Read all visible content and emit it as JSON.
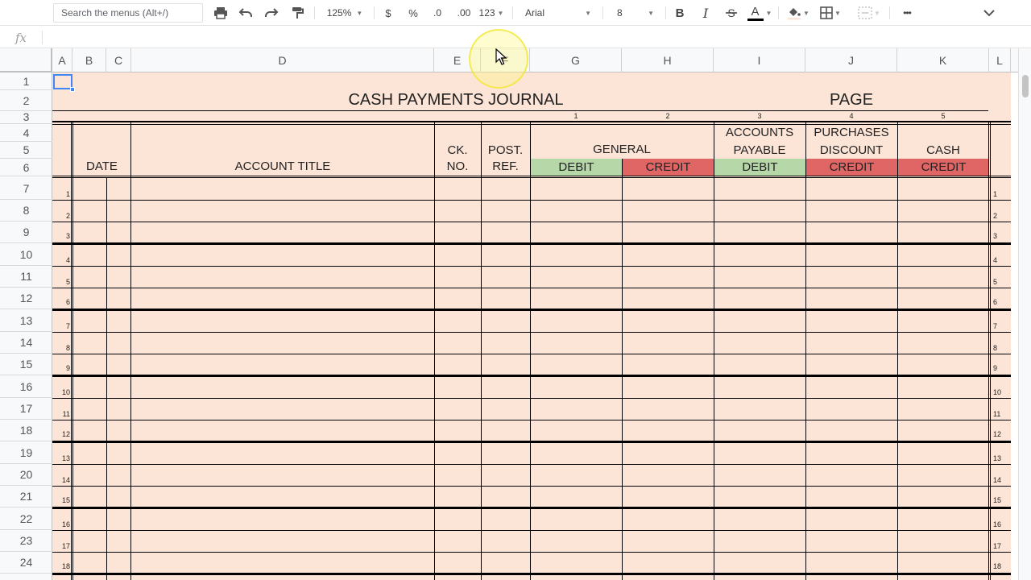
{
  "toolbar": {
    "search_placeholder": "Search the menus (Alt+/)",
    "currency": "$",
    "percent": "%",
    "dec_decrease": ".0",
    "dec_increase": ".00",
    "zoom": "125%",
    "format_more": "123",
    "font": "Arial",
    "font_size": "8",
    "bold": "B",
    "italic": "I",
    "text_color_label": "A",
    "more": "•••"
  },
  "formula_bar": {
    "fx_label": "fx",
    "value": ""
  },
  "columns": [
    "A",
    "B",
    "C",
    "D",
    "E",
    "F",
    "G",
    "H",
    "I",
    "J",
    "K",
    "L"
  ],
  "rows": [
    "1",
    "2",
    "3",
    "4",
    "5",
    "6",
    "7",
    "8",
    "9",
    "10",
    "11",
    "12",
    "13",
    "14",
    "15",
    "16",
    "17",
    "18",
    "19",
    "20",
    "21",
    "22",
    "23",
    "24"
  ],
  "journal": {
    "title": "CASH PAYMENTS JOURNAL",
    "page_label": "PAGE",
    "col_numbers": [
      "1",
      "2",
      "3",
      "4",
      "5"
    ],
    "headers": {
      "date": "DATE",
      "account_title": "ACCOUNT TITLE",
      "ck_no_1": "CK.",
      "ck_no_2": "NO.",
      "post_ref_1": "POST.",
      "post_ref_2": "REF.",
      "general": "GENERAL",
      "accounts_payable_1": "ACCOUNTS",
      "accounts_payable_2": "PAYABLE",
      "purchases_discount_1": "PURCHASES",
      "purchases_discount_2": "DISCOUNT",
      "cash": "CASH"
    },
    "sub_headers": [
      {
        "label": "DEBIT",
        "color": "#b6d7a8"
      },
      {
        "label": "CREDIT",
        "color": "#e06666"
      },
      {
        "label": "DEBIT",
        "color": "#b6d7a8"
      },
      {
        "label": "CREDIT",
        "color": "#e06666"
      },
      {
        "label": "CREDIT",
        "color": "#e06666"
      }
    ],
    "line_numbers": [
      "1",
      "2",
      "3",
      "4",
      "5",
      "6",
      "7",
      "8",
      "9",
      "10",
      "11",
      "12",
      "13",
      "14",
      "15",
      "16",
      "17",
      "18"
    ]
  },
  "colors": {
    "sheet_bg": "#fce4d6",
    "debit_green": "#b6d7a8",
    "credit_red": "#e06666",
    "selection_blue": "#4285f4"
  }
}
